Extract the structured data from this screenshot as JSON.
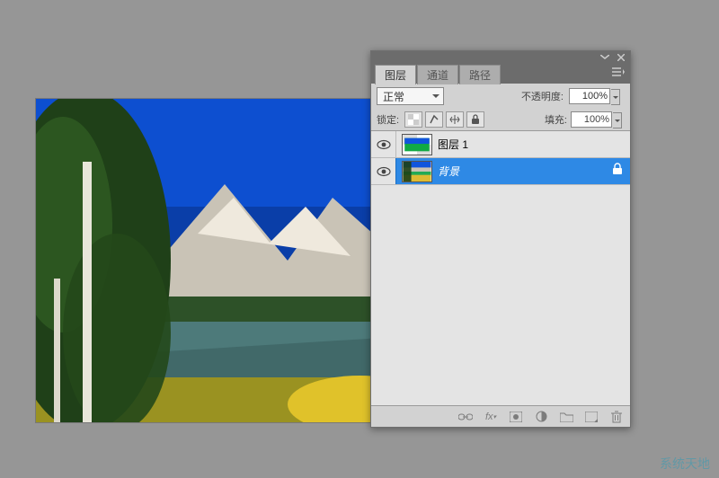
{
  "tabs": {
    "layers": "图层",
    "channels": "通道",
    "paths": "路径"
  },
  "blend": {
    "mode": "正常",
    "opacity_label": "不透明度:",
    "opacity_value": "100%"
  },
  "lock": {
    "label": "锁定:",
    "fill_label": "填充:",
    "fill_value": "100%"
  },
  "layers_list": [
    {
      "name": "图层 1",
      "italic": false,
      "selected": false,
      "locked": false
    },
    {
      "name": "背景",
      "italic": true,
      "selected": true,
      "locked": true
    }
  ],
  "watermark": "系统天地"
}
